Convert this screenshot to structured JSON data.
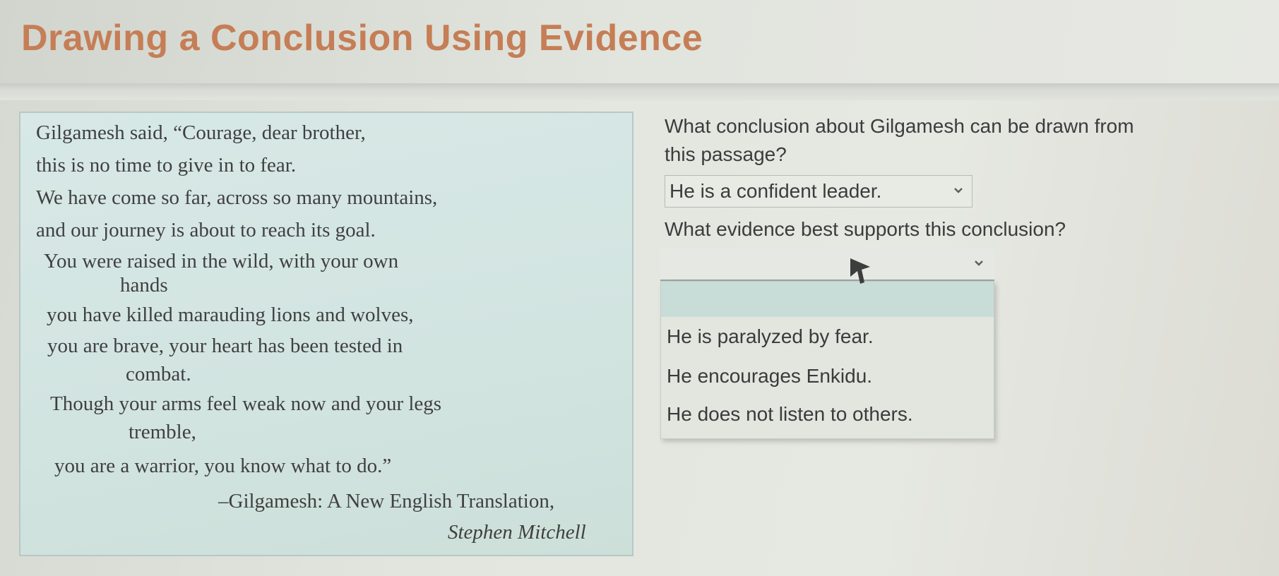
{
  "header": {
    "title": "Drawing a Conclusion Using Evidence"
  },
  "passage": {
    "lines": [
      "Gilgamesh said, “Courage, dear brother,",
      "this is no time to give in to fear.",
      "We have come so far, across so many mountains,",
      "and our journey is about to reach its goal.",
      "You were raised in the wild, with your own",
      "hands",
      "you have killed marauding lions and wolves,",
      "you are brave, your heart has been tested in",
      "combat.",
      "Though your arms feel weak now and your legs",
      "tremble,",
      "you are a warrior, you know what to do.”"
    ],
    "citation": "–Gilgamesh: A New English Translation,",
    "author": "Stephen Mitchell"
  },
  "question1": {
    "text_line1": "What conclusion about Gilgamesh can be drawn from",
    "text_line2": "this passage?",
    "selected": "He is a confident leader."
  },
  "question2": {
    "text": "What evidence best supports this conclusion?",
    "selected": "",
    "options": [
      "",
      "He is paralyzed by fear.",
      "He encourages Enkidu.",
      "He does not listen to others."
    ]
  },
  "icons": {
    "caret": "chevron-down-icon",
    "cursor": "mouse-pointer-icon"
  },
  "colors": {
    "title": "#c57e55",
    "passage_bg": "#d7e8e6",
    "highlight": "#c8dcd8"
  }
}
